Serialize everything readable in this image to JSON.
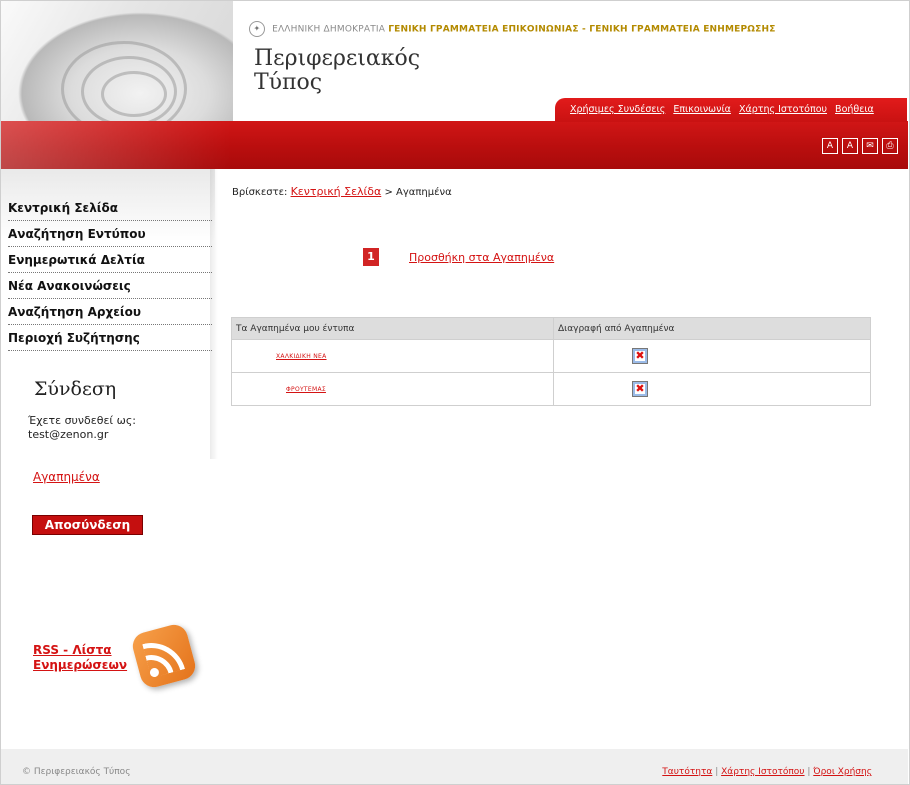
{
  "header": {
    "gov_prefix": "ΕΛΛΗΝΙΚΗ ΔΗΜΟΚΡΑΤΙΑ",
    "gov_ministries": "ΓΕΝΙΚΗ ΓΡΑΜΜΑΤΕΙΑ ΕΠΙΚΟΙΝΩΝΙΑΣ - ΓΕΝΙΚΗ ΓΡΑΜΜΑΤΕΙΑ ΕΝΗΜΕΡΩΣΗΣ",
    "title_line1": "Περιφερειακός",
    "title_line2": "Τύπος",
    "top_links": [
      "Χρήσιμες Συνδέσεις",
      "Επικοινωνία",
      "Χάρτης Ιστοτόπου",
      "Βοήθεια"
    ],
    "tools": [
      "A",
      "A",
      "✉",
      "⎙"
    ]
  },
  "sidebar": {
    "menu": [
      "Κεντρική Σελίδα",
      "Αναζήτηση Εντύπου",
      "Ενημερωτικά Δελτία",
      "Νέα Ανακοινώσεις",
      "Αναζήτηση Αρχείου",
      "Περιοχή Συζήτησης"
    ],
    "login_title": "Σύνδεση",
    "logged_as": "Έχετε συνδεθεί ως:",
    "user_email": "test@zenon.gr",
    "favorites_link": "Αγαπημένα",
    "logout_label": "Αποσύνδεση",
    "rss_label": "RSS - Λίστα Ενημερώσεων"
  },
  "main": {
    "breadcrumb_prefix": "Βρίσκεστε:",
    "breadcrumb_home": "Κεντρική Σελίδα",
    "breadcrumb_sep": " > ",
    "breadcrumb_current": "Αγαπημένα",
    "add_badge": "1",
    "add_link": "Προσθήκη στα Αγαπημένα",
    "table": {
      "col1": "Τα Αγαπημένα μου έντυπα",
      "col2": "Διαγραφή από Αγαπημένα",
      "rows": [
        {
          "name": "ΧΑΛΚΙΔΙΚΗ ΝΕΑ"
        },
        {
          "name": "ΦΡΟΥΤΕΜΑΣ"
        }
      ],
      "delete_glyph": "✖"
    }
  },
  "footer": {
    "copyright": "© Περιφερειακός Τύπος",
    "links": [
      "Ταυτότητα",
      "Χάρτης Ιστοτόπου",
      "Όροι Χρήσης"
    ],
    "sep": " | "
  }
}
